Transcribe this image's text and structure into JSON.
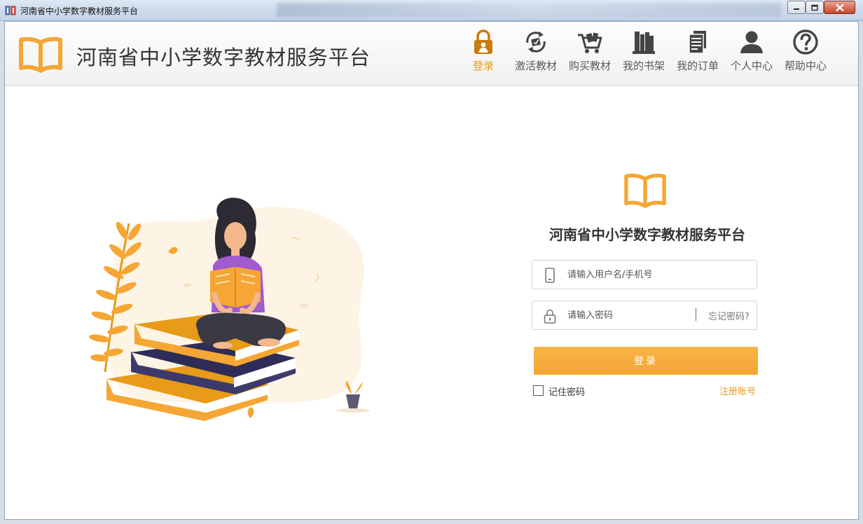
{
  "window": {
    "title": "河南省中小学数字教材服务平台"
  },
  "header": {
    "title": "河南省中小学数字教材服务平台",
    "nav": [
      {
        "label": "登录",
        "icon": "lock-person-icon",
        "active": true
      },
      {
        "label": "激活教材",
        "icon": "activate-refresh-icon"
      },
      {
        "label": "购买教材",
        "icon": "shopping-cart-icon"
      },
      {
        "label": "我的书架",
        "icon": "bookshelf-icon"
      },
      {
        "label": "我的订单",
        "icon": "order-list-icon"
      },
      {
        "label": "个人中心",
        "icon": "user-icon"
      },
      {
        "label": "帮助中心",
        "icon": "help-question-icon"
      }
    ]
  },
  "login": {
    "title": "河南省中小学数字教材服务平台",
    "username_placeholder": "请输入用户名/手机号",
    "password_placeholder": "请输入密码",
    "forgot_label": "忘记密码?",
    "submit_label": "登录",
    "remember_label": "记住密码",
    "register_label": "注册账号"
  },
  "colors": {
    "accent": "#F5A634",
    "nav_active": "#E89A19",
    "text_dark": "#333333"
  }
}
